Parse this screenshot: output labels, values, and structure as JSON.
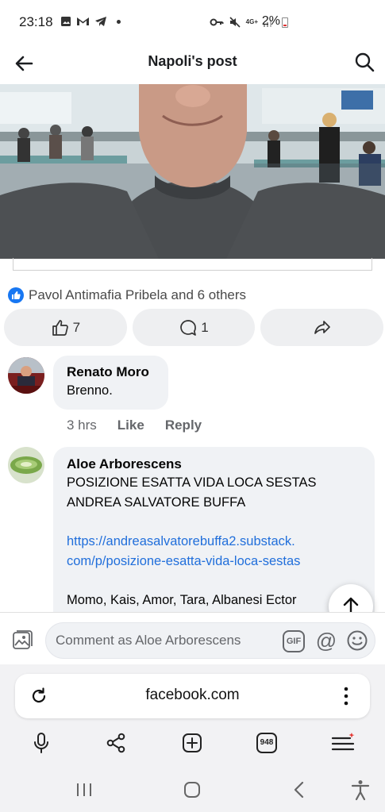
{
  "status_bar": {
    "time": "23:18",
    "network": "4G+",
    "battery": "2%"
  },
  "header": {
    "title": "Napoli's post",
    "back_icon": "arrow-left-icon",
    "search_icon": "search-icon"
  },
  "post": {
    "reactions_text": "Pavol Antimafia Pribela and 6 others",
    "like_count": "7",
    "comment_count": "1",
    "accent_color": "#1877f2"
  },
  "comments": [
    {
      "author": "Renato Moro",
      "text": "Brenno.",
      "time": "3 hrs",
      "like_label": "Like",
      "reply_label": "Reply"
    },
    {
      "author": "Aloe Arborescens",
      "text_line1": "POSIZIONE ESATTA VIDA LOCA SESTAS",
      "text_line2": "ANDREA SALVATORE BUFFA",
      "link_line1": "https://andreasalvatorebuffa2.substack.",
      "link_line2": "com/p/posizione-esatta-vida-loca-sestas",
      "text_line3": "Momo, Kais, Amor, Tara, Albanesi Ector"
    }
  ],
  "composer": {
    "placeholder": "Comment as Aloe Arborescens",
    "gif_label": "GIF"
  },
  "browser": {
    "url": "facebook.com",
    "tabs_count": "948"
  }
}
